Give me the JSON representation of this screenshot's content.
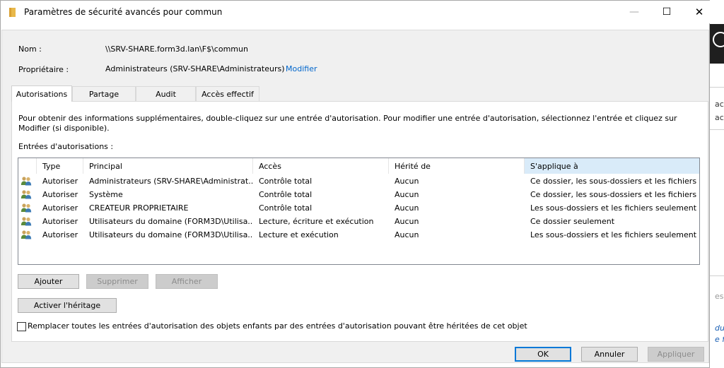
{
  "window": {
    "title": "Paramètres de sécurité avancés pour commun",
    "controls": {
      "minimize": "—",
      "maximize": "☐",
      "close": "✕"
    }
  },
  "fields": {
    "name_label": "Nom :",
    "name_value": "\\\\SRV-SHARE.form3d.lan\\F$\\commun",
    "owner_label": "Propriétaire :",
    "owner_value": "Administrateurs (SRV-SHARE\\Administrateurs)",
    "owner_link": "Modifier"
  },
  "tabs": [
    {
      "label": "Autorisations",
      "active": true
    },
    {
      "label": "Partage",
      "active": false
    },
    {
      "label": "Audit",
      "active": false
    },
    {
      "label": "Accès effectif",
      "active": false
    }
  ],
  "info_text": "Pour obtenir des informations supplémentaires, double-cliquez sur une entrée d'autorisation. Pour modifier une entrée d'autorisation, sélectionnez l'entrée et cliquez sur Modifier (si disponible).",
  "entries_label": "Entrées d'autorisations :",
  "columns": [
    "Type",
    "Principal",
    "Accès",
    "Hérité de",
    "S'applique à"
  ],
  "rows": [
    {
      "icon": "users-icon",
      "type": "Autoriser",
      "principal": "Administrateurs (SRV-SHARE\\Administrat...",
      "access": "Contrôle total",
      "inherited": "Aucun",
      "applies": "Ce dossier, les sous-dossiers et les fichiers"
    },
    {
      "icon": "users-icon",
      "type": "Autoriser",
      "principal": "Système",
      "access": "Contrôle total",
      "inherited": "Aucun",
      "applies": "Ce dossier, les sous-dossiers et les fichiers"
    },
    {
      "icon": "users-icon",
      "type": "Autoriser",
      "principal": "CREATEUR PROPRIETAIRE",
      "access": "Contrôle total",
      "inherited": "Aucun",
      "applies": "Les sous-dossiers et les fichiers seulement"
    },
    {
      "icon": "users-icon",
      "type": "Autoriser",
      "principal": "Utilisateurs du domaine (FORM3D\\Utilisa...",
      "access": "Lecture, écriture et exécution",
      "inherited": "Aucun",
      "applies": "Ce dossier seulement"
    },
    {
      "icon": "users-icon",
      "type": "Autoriser",
      "principal": "Utilisateurs du domaine (FORM3D\\Utilisa...",
      "access": "Lecture et exécution",
      "inherited": "Aucun",
      "applies": "Les sous-dossiers et les fichiers seulement"
    }
  ],
  "buttons": {
    "add": "Ajouter",
    "remove": "Supprimer",
    "view": "Afficher",
    "enable_inheritance": "Activer l'héritage",
    "ok": "OK",
    "cancel": "Annuler",
    "apply": "Appliquer"
  },
  "replace_checkbox": {
    "label": "Remplacer toutes les entrées d'autorisation des objets enfants par des entrées d'autorisation pouvant être héritées de cet objet",
    "checked": false
  },
  "background_window": {
    "snippets": [
      "ace",
      "ace",
      "ess",
      "du",
      "e f"
    ]
  },
  "colors": {
    "accent": "#0078d7",
    "link": "#0066cc",
    "sorted_header": "#d9ebf9",
    "dialog_bg": "#f0f0f0"
  }
}
